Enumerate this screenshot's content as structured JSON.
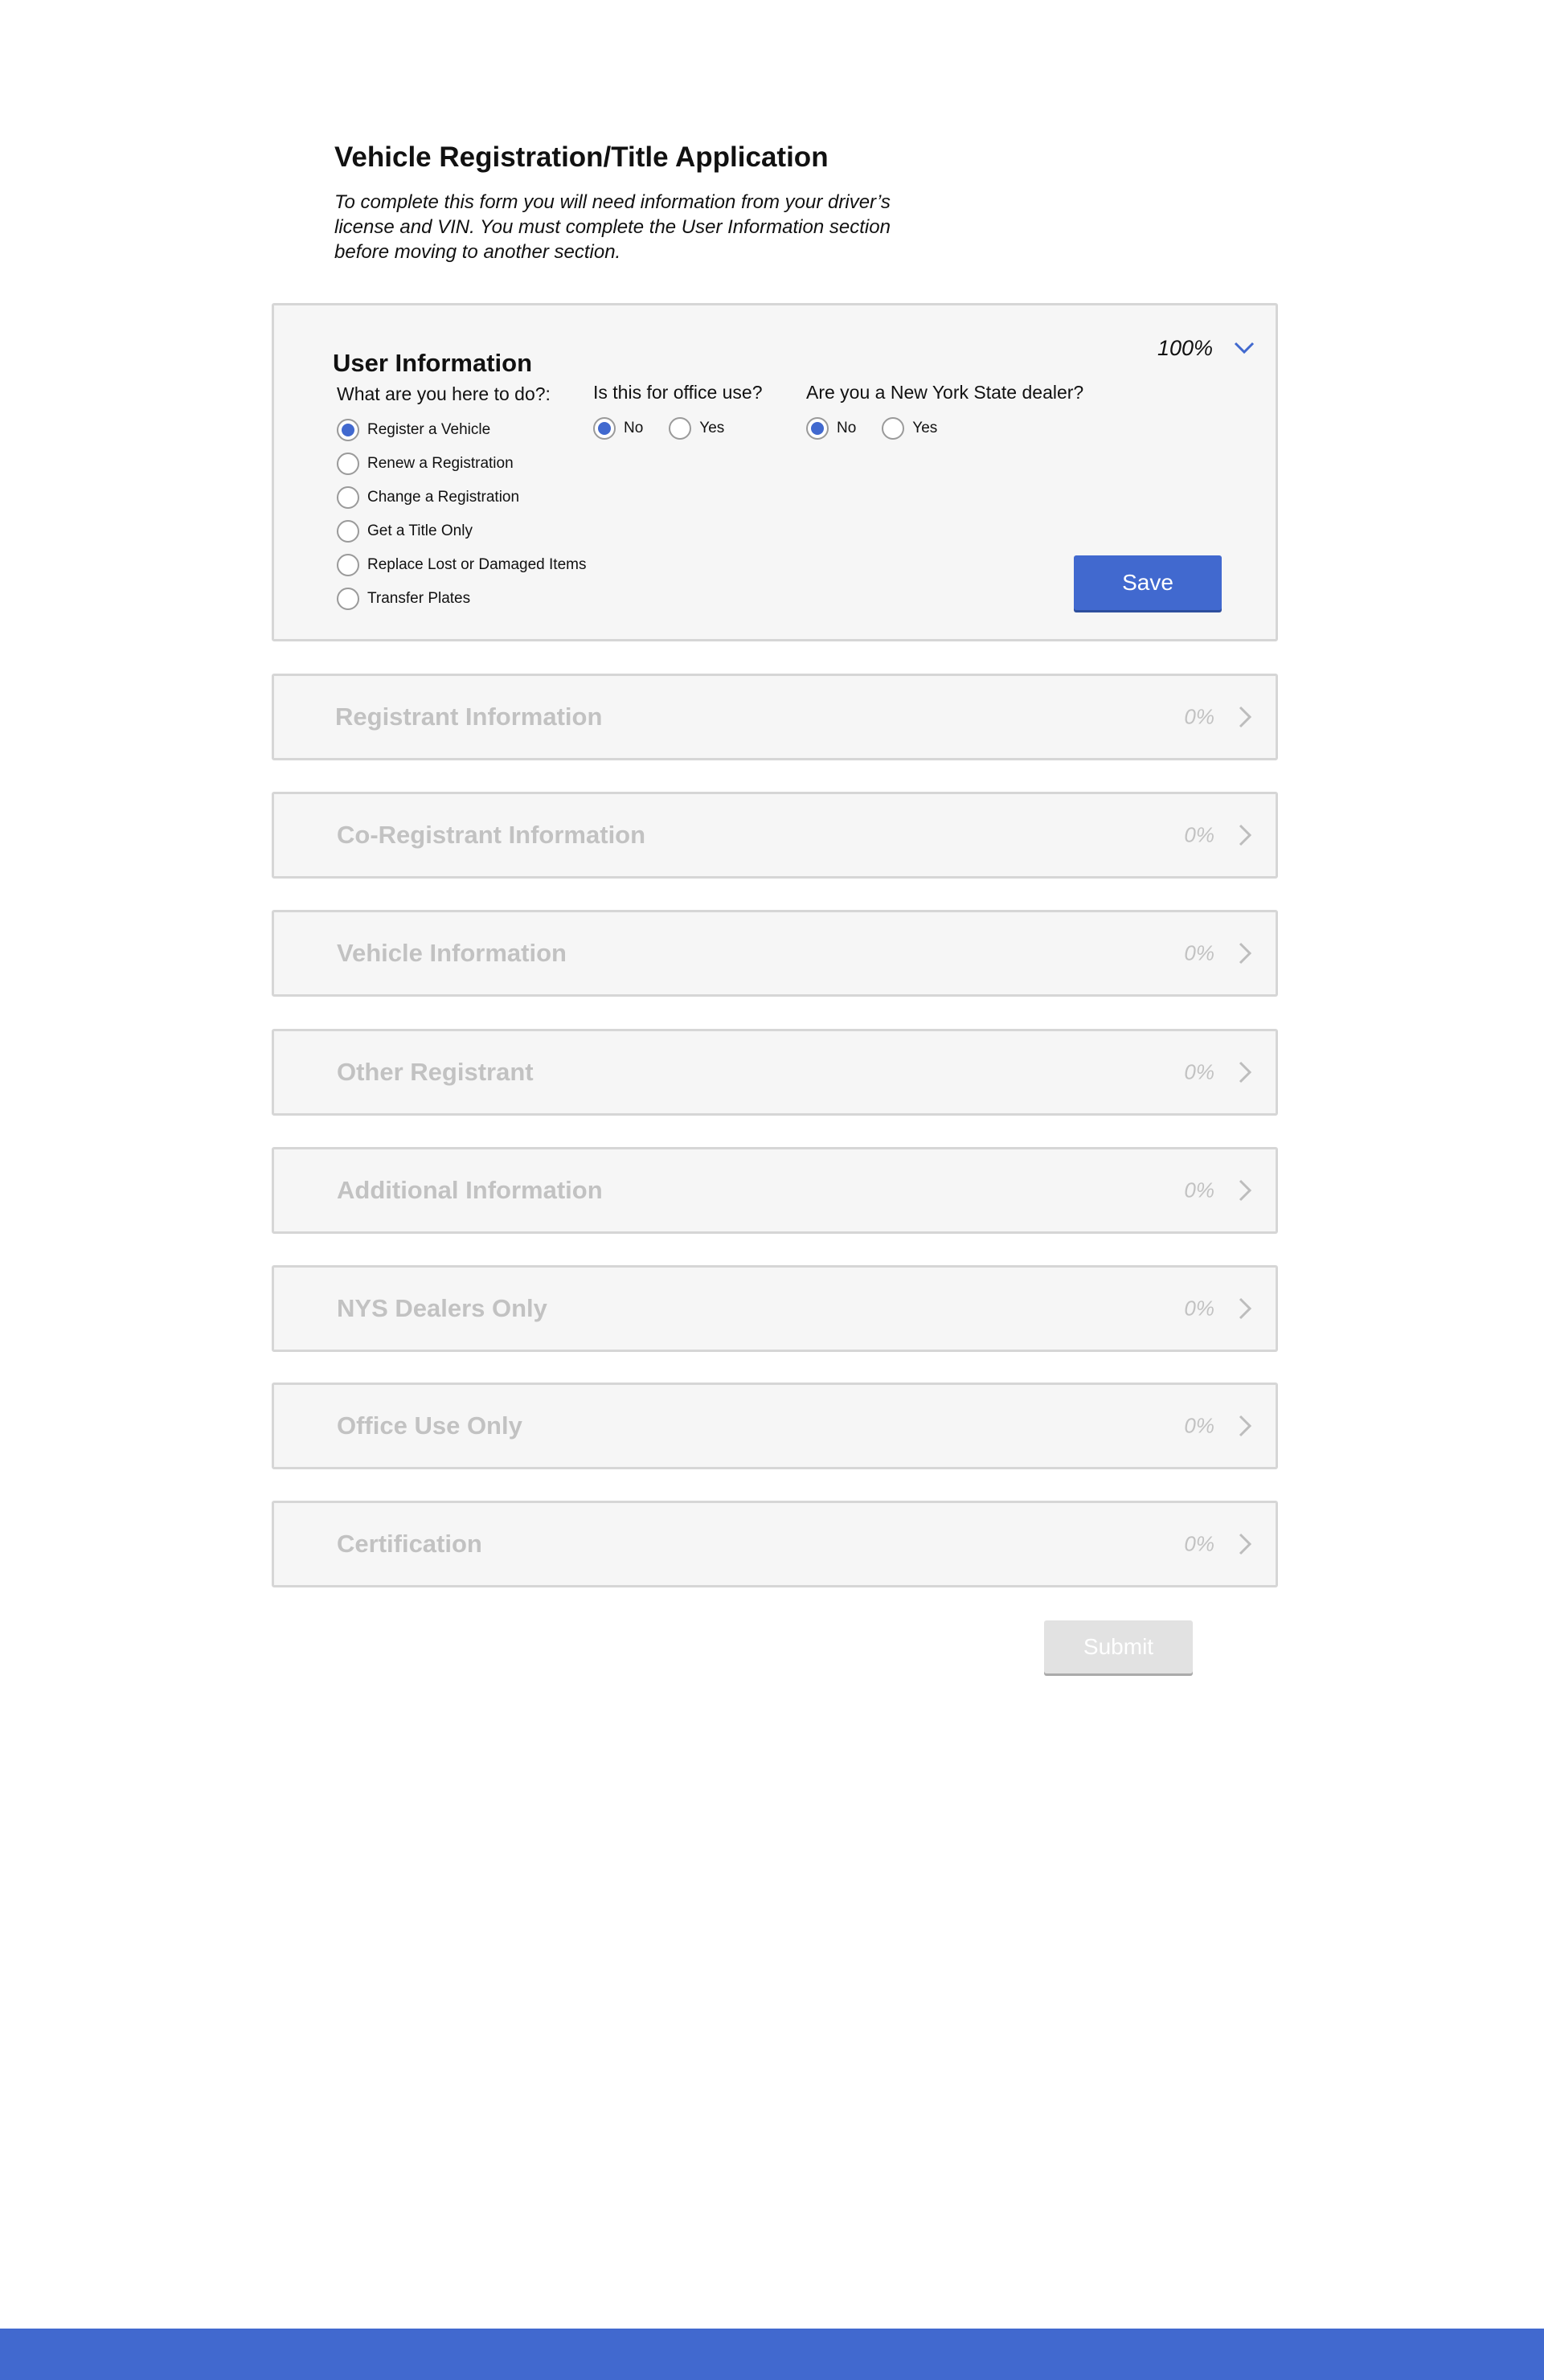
{
  "page": {
    "title": "Vehicle Registration/Title Application",
    "intro": "To complete this form you will need information from your driver’s license and VIN. You must complete the User Information section before moving to another section."
  },
  "user_info": {
    "title": "User Information",
    "percent": "100%",
    "expanded": true,
    "q1": {
      "label": "What are you here to do?:",
      "options": [
        {
          "label": "Register a Vehicle",
          "selected": true
        },
        {
          "label": "Renew a Registration",
          "selected": false
        },
        {
          "label": "Change a Registration",
          "selected": false
        },
        {
          "label": "Get a Title Only",
          "selected": false
        },
        {
          "label": "Replace Lost or Damaged Items",
          "selected": false
        },
        {
          "label": "Transfer Plates",
          "selected": false
        }
      ]
    },
    "q2": {
      "label": "Is this for office use?",
      "options": [
        {
          "label": "No",
          "selected": true
        },
        {
          "label": "Yes",
          "selected": false
        }
      ]
    },
    "q3": {
      "label": "Are you a New York State dealer?",
      "options": [
        {
          "label": "No",
          "selected": true
        },
        {
          "label": "Yes",
          "selected": false
        }
      ]
    },
    "save_label": "Save"
  },
  "sections": [
    {
      "title": "Registrant Information",
      "percent": "0%"
    },
    {
      "title": "Co-Registrant Information",
      "percent": "0%"
    },
    {
      "title": "Vehicle Information",
      "percent": "0%"
    },
    {
      "title": "Other Registrant",
      "percent": "0%"
    },
    {
      "title": "Additional Information",
      "percent": "0%"
    },
    {
      "title": "NYS Dealers Only",
      "percent": "0%"
    },
    {
      "title": "Office Use Only",
      "percent": "0%"
    },
    {
      "title": "Certification",
      "percent": "0%"
    }
  ],
  "submit_label": "Submit",
  "colors": {
    "accent": "#4169cf",
    "panel_bg": "#f6f6f6",
    "panel_border": "#d6d6d6",
    "disabled_text": "#c2c2c2"
  },
  "icons": {
    "expanded": "chevron-down-icon",
    "collapsed": "chevron-right-icon",
    "radio_selected": "radio-selected",
    "radio_unselected": "radio-unselected"
  }
}
